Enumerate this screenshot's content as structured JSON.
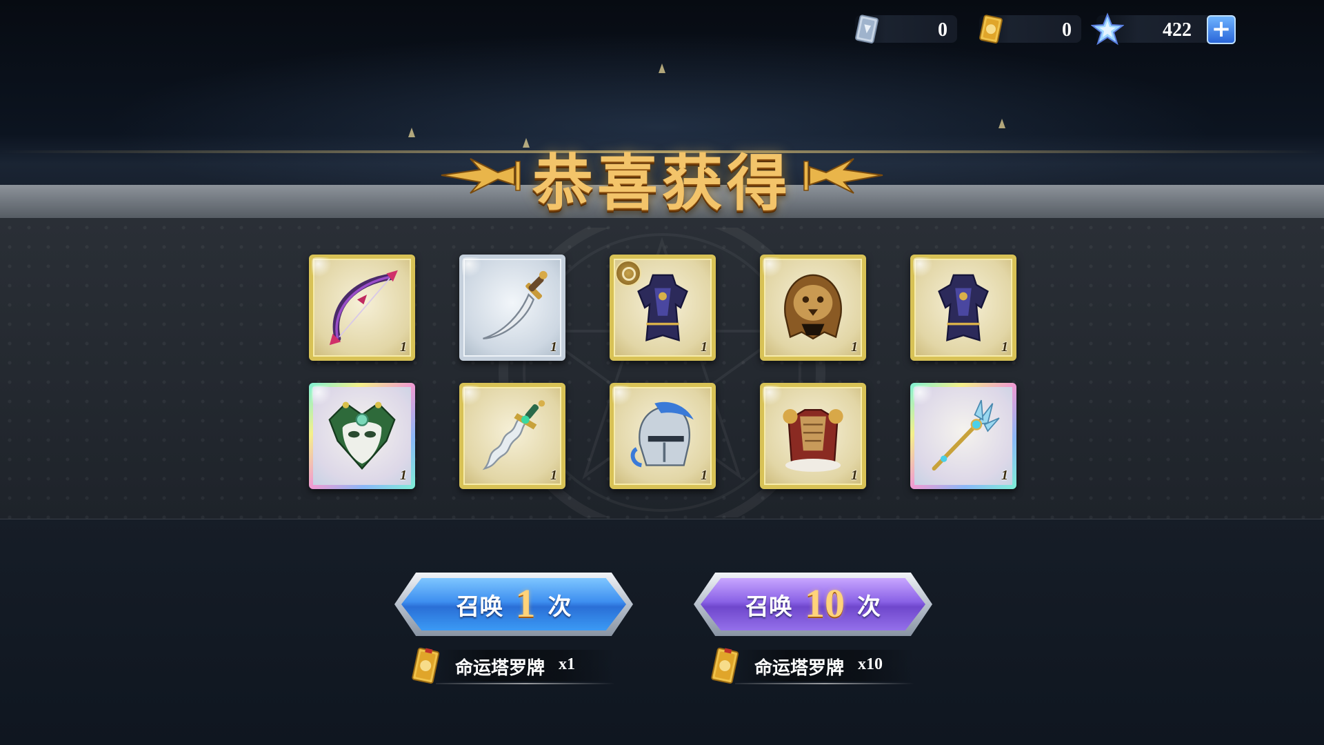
{
  "currency": {
    "silver_ticket": {
      "icon": "silver-card-icon",
      "value": "0"
    },
    "gold_tarot": {
      "icon": "gold-tarot-card-icon",
      "value": "0"
    },
    "star_gem": {
      "icon": "star-gem-icon",
      "value": "422"
    },
    "add_label": "+"
  },
  "banner": {
    "title": "恭喜获得"
  },
  "items": [
    {
      "rarity": "gold",
      "icon": "bow-icon",
      "count": "1"
    },
    {
      "rarity": "silver",
      "icon": "dagger-icon",
      "count": "1"
    },
    {
      "rarity": "gold",
      "icon": "armor-robe-icon",
      "count": "1",
      "badge": "coin-badge-icon"
    },
    {
      "rarity": "gold",
      "icon": "lion-helmet-icon",
      "count": "1"
    },
    {
      "rarity": "gold",
      "icon": "armor-robe-icon",
      "count": "1"
    },
    {
      "rarity": "rainbow",
      "icon": "jester-mask-icon",
      "count": "1"
    },
    {
      "rarity": "gold",
      "icon": "wavy-sword-icon",
      "count": "1"
    },
    {
      "rarity": "gold",
      "icon": "knight-helmet-icon",
      "count": "1"
    },
    {
      "rarity": "gold",
      "icon": "fur-armor-icon",
      "count": "1"
    },
    {
      "rarity": "rainbow",
      "icon": "trident-staff-icon",
      "count": "1"
    }
  ],
  "summon_once": {
    "prefix": "召唤",
    "number": "1",
    "suffix": "次",
    "cost_name": "命运塔罗牌",
    "cost_qty": "x1"
  },
  "summon_ten": {
    "prefix": "召唤",
    "number": "10",
    "suffix": "次",
    "cost_name": "命运塔罗牌",
    "cost_qty": "x10"
  },
  "colors": {
    "gold_frame": "#d8c256",
    "silver_frame": "#c5d0dc",
    "title_gold": "#f3c46a",
    "summon_blue": "#3e8ff0",
    "summon_purple": "#8a62e6"
  }
}
